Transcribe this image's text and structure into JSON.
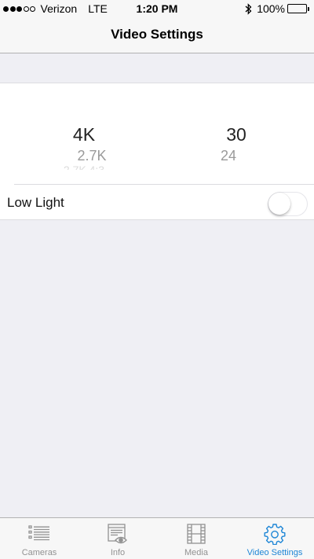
{
  "status_bar": {
    "carrier": "Verizon",
    "network": "LTE",
    "time": "1:20 PM",
    "battery_percent": "100%",
    "signal_bars_filled": 3,
    "signal_bars_total": 5,
    "battery_level": 1.0
  },
  "nav": {
    "title": "Video Settings"
  },
  "picker": {
    "resolution": {
      "selected": "4K",
      "next": "2.7K",
      "faded": "2.7K 4:3"
    },
    "frame_rate": {
      "selected": "30",
      "next": "24"
    }
  },
  "low_light": {
    "label": "Low Light",
    "enabled": false
  },
  "tabs": [
    {
      "label": "Cameras",
      "icon": "list-icon",
      "active": false
    },
    {
      "label": "Info",
      "icon": "info-eye-icon",
      "active": false
    },
    {
      "label": "Media",
      "icon": "film-icon",
      "active": false
    },
    {
      "label": "Video Settings",
      "icon": "gear-icon",
      "active": true
    }
  ],
  "colors": {
    "accent": "#1e86d6",
    "background": "#efeff4",
    "inactive_tab": "#929292",
    "battery": "#4cd964"
  }
}
